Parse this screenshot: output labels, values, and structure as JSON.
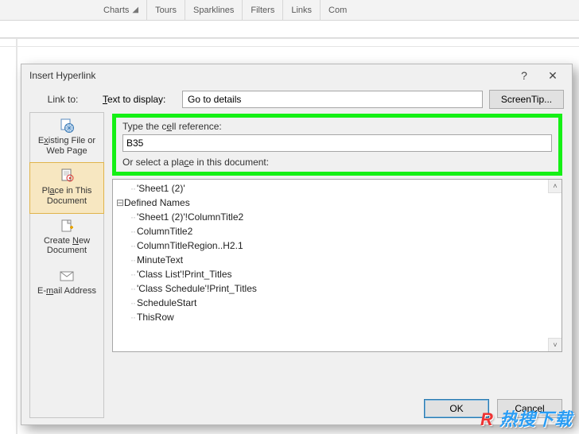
{
  "ribbon": {
    "groups": [
      "Charts",
      "Tours",
      "Sparklines",
      "Filters",
      "Links",
      "Com"
    ]
  },
  "dialog": {
    "title": "Insert Hyperlink",
    "help_tooltip": "?",
    "link_to_label": "Link to:",
    "text_to_display_label": "Text to display:",
    "text_to_display_value": "Go to details",
    "screentip_label": "ScreenTip...",
    "sidebar": {
      "items": [
        {
          "label": "Existing File or Web Page",
          "key": "existing-file"
        },
        {
          "label": "Place in This Document",
          "key": "place-in-doc"
        },
        {
          "label": "Create New Document",
          "key": "create-new"
        },
        {
          "label": "E-mail Address",
          "key": "email"
        }
      ],
      "selected_index": 1
    },
    "main": {
      "cell_ref_label": "Type the cell reference:",
      "cell_ref_value": "B35",
      "select_place_label": "Or select a place in this document:",
      "tree": [
        {
          "level": 1,
          "text": "'Sheet1 (2)'",
          "glyph": ""
        },
        {
          "level": 0,
          "text": "Defined Names",
          "glyph": "−"
        },
        {
          "level": 1,
          "text": "'Sheet1 (2)'!ColumnTitle2",
          "glyph": ""
        },
        {
          "level": 1,
          "text": "ColumnTitle2",
          "glyph": ""
        },
        {
          "level": 1,
          "text": "ColumnTitleRegion..H2.1",
          "glyph": ""
        },
        {
          "level": 1,
          "text": "MinuteText",
          "glyph": ""
        },
        {
          "level": 1,
          "text": "'Class List'!Print_Titles",
          "glyph": ""
        },
        {
          "level": 1,
          "text": "'Class Schedule'!Print_Titles",
          "glyph": ""
        },
        {
          "level": 1,
          "text": "ScheduleStart",
          "glyph": ""
        },
        {
          "level": 1,
          "text": "ThisRow",
          "glyph": ""
        }
      ]
    },
    "buttons": {
      "ok": "OK",
      "cancel": "Cancel"
    }
  },
  "watermark": {
    "text": "R 热搜下载"
  }
}
